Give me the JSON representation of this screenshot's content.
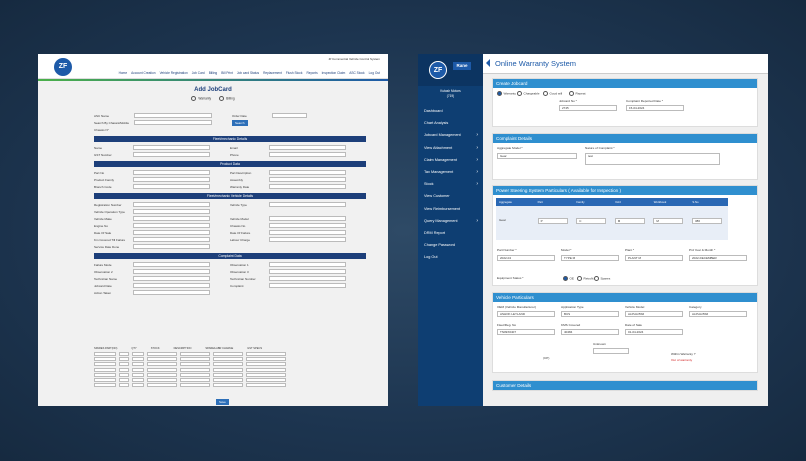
{
  "left": {
    "sys_name": "Zf Commercial Vehicle Control System",
    "nav": [
      "Home",
      "Account Creation",
      "Vehicle Registration",
      "Job Card",
      "Billing",
      "Bill Print",
      "Job card Status",
      "Replacement",
      "Flush Stock",
      "Reports",
      "Inspection Claim",
      "ASC Stock",
      "Log Out"
    ],
    "title": "Add JobCard",
    "radios": [
      "Warranty",
      "Billing"
    ],
    "top_fields": [
      {
        "l": "ASC Name",
        "l2": "Order Date"
      },
      {
        "l": "Search By Chassis/Mobile",
        "l2": ""
      },
      {
        "l": "Chassis N°",
        "l2": ""
      }
    ],
    "search_btn": "Search",
    "sections": [
      {
        "title": "Fleet/mechanic Details",
        "rows": [
          [
            "Name",
            "Email"
          ],
          [
            "GST Number",
            "Phone"
          ]
        ]
      },
      {
        "title": "Product Data",
        "rows": [
          [
            "Part No",
            "Part Description"
          ],
          [
            "Product Family",
            "Assembly"
          ],
          [
            "Branch Code",
            "Warranty Date"
          ]
        ]
      },
      {
        "title": "Fleet/mechanic Vehicle Details",
        "rows": [
          [
            "Registration Number",
            "Vehicle Type"
          ],
          [
            "Vehicle Operation Type",
            ""
          ],
          [
            "Vehicle Make",
            "Vehicle Model"
          ],
          [
            "Engine No",
            "Chassis No"
          ],
          [
            "Date Of Sale",
            "Date Of Failure"
          ],
          [
            "Km Covered Till Failure",
            "Labour Charge"
          ],
          [
            "Service Date Done",
            ""
          ]
        ]
      },
      {
        "title": "Complaint Data",
        "rows": [
          [
            "Failure Mode",
            "Observation 1"
          ],
          [
            "Observation 2",
            "Observation 3"
          ],
          [
            "Technician Name",
            "Technician Number"
          ],
          [
            "Jobcard Date",
            "Complaint"
          ],
          [
            "Action Taken",
            ""
          ]
        ]
      }
    ],
    "parts_headers": [
      "SPARES PART(NO)",
      "QTY",
      "STOCK",
      "DESCRIPTION",
      "SPARE/LABR CHARGE",
      "GST SPECS"
    ],
    "save": "Save"
  },
  "right": {
    "rane": "Rane",
    "user": [
      "Kutash Motors",
      "(719)"
    ],
    "menu": [
      {
        "label": "Dashboard",
        "arrow": false
      },
      {
        "label": "Chart Analysis",
        "arrow": false
      },
      {
        "label": "Jobcard Management",
        "arrow": true
      },
      {
        "label": "View Attachment",
        "arrow": true
      },
      {
        "label": "Claim Management",
        "arrow": true
      },
      {
        "label": "Tax Management",
        "arrow": true
      },
      {
        "label": "Stock",
        "arrow": true
      },
      {
        "label": "View Customer",
        "arrow": false
      },
      {
        "label": "View Reimbursement",
        "arrow": false
      },
      {
        "label": "Query Management",
        "arrow": true
      },
      {
        "label": "DRM Report",
        "arrow": false
      },
      {
        "label": "Change Password",
        "arrow": false
      },
      {
        "label": "Log Out",
        "arrow": false
      }
    ],
    "page_title": "Online Warranty System",
    "create_jobcard": {
      "title": "Create Jobcard",
      "radios": [
        "Warranty",
        "Chargeable",
        "Good will",
        "Repeat"
      ],
      "jobcard_no_label": "Jobcard No *",
      "jobcard_no": "2745",
      "reported_label": "Complaint Reported Date *",
      "reported": "15-04-2024"
    },
    "complaint": {
      "title": "Complaint Details",
      "aggregate_label": "Aggregate Model *",
      "aggregate": "Gear",
      "nature_label": "Nature of Complaint *",
      "nature": "test"
    },
    "pss": {
      "title": "Power Steering System Particulars ( Available for Inspection )",
      "headers": [
        "Aggregate",
        "Part",
        "Family",
        "Vol.h",
        "Workbook",
        "S.No"
      ],
      "row": [
        "Gear",
        "P",
        "C",
        "M",
        "M",
        "386"
      ],
      "part_no_label": "Part Number *",
      "part_no": "2022-04",
      "model_label": "Model *",
      "model": "TYPE M",
      "plant_label": "Plant *",
      "plant": "PLANT M",
      "mfg_label": "Prd Year & Month *",
      "mfg": "2022-DECEMBER",
      "eq_label": "Equipment Status *",
      "eq_options": [
        "OE",
        "Retrofit",
        "Spares"
      ]
    },
    "vehicle": {
      "title": "Vehicle Particulars",
      "f1": [
        {
          "l": "OEM (Vehicle Manufacturer)",
          "v": "ASHOK LEYLAND"
        },
        {
          "l": "Application Type",
          "v": "BUS"
        },
        {
          "l": "Vehicle Model",
          "v": "ALPHA BS6"
        },
        {
          "l": "Category",
          "v": "ALPHA BS6"
        }
      ],
      "f2": [
        {
          "l": "Fleet/Reg. No",
          "v": "TN09X0407"
        },
        {
          "l": "KMS Covered",
          "v": "40484"
        },
        {
          "l": "Date of Sale",
          "v": "01-04-2024"
        }
      ],
      "uncovered_label": "Unknown",
      "cpc_label": "(CP)",
      "warranty_label": "Within Warranty ?",
      "warranty_status": "Out of warranty"
    },
    "customer_title": "Customer Details"
  }
}
